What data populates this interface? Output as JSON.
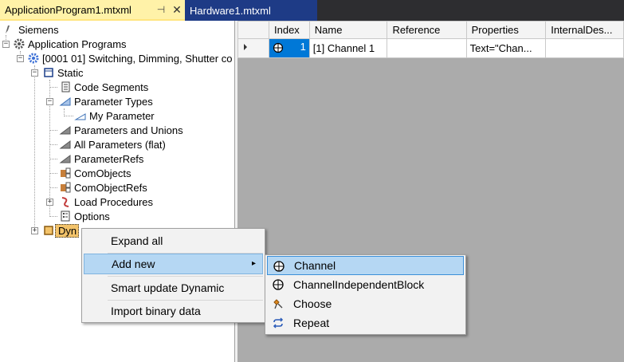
{
  "tabs": {
    "active_label": "ApplicationProgram1.mtxml",
    "pin_icon": "pin-icon",
    "close_icon": "close-icon",
    "inactive_label": "Hardware1.mtxml"
  },
  "tree": {
    "root": "Siemens",
    "app_programs": "Application Programs",
    "program": "[0001 01] Switching, Dimming, Shutter co",
    "static": "Static",
    "code_segments": "Code Segments",
    "parameter_types": "Parameter Types",
    "my_parameter": "My Parameter",
    "parameters_and_unions": "Parameters and Unions",
    "all_parameters": "All Parameters (flat)",
    "parameter_refs": "ParameterRefs",
    "com_objects": "ComObjects",
    "com_object_refs": "ComObjectRefs",
    "load_procedures": "Load Procedures",
    "options": "Options",
    "dynamic": "Dyn"
  },
  "grid": {
    "columns": [
      "Index",
      "Name",
      "Reference",
      "Properties",
      "InternalDes..."
    ],
    "rows": [
      {
        "index": "1",
        "name": "[1] Channel 1",
        "reference": "",
        "properties": "Text=\"Chan...",
        "internal": ""
      }
    ]
  },
  "context_menu": {
    "items": [
      {
        "label": "Expand all"
      },
      {
        "label": "Add new",
        "has_submenu": true
      },
      {
        "label": "Smart update Dynamic"
      },
      {
        "label": "Import binary data"
      }
    ],
    "arrow": "▸"
  },
  "submenu": {
    "items": [
      {
        "label": "Channel",
        "icon": "channel-icon"
      },
      {
        "label": "ChannelIndependentBlock",
        "icon": "channel-independent-block-icon"
      },
      {
        "label": "Choose",
        "icon": "choose-icon"
      },
      {
        "label": "Repeat",
        "icon": "repeat-icon"
      }
    ]
  },
  "colors": {
    "active_tab": "#fff2a8",
    "inactive_tab": "#1e3b86",
    "tabstrip_bg": "#2d2d30",
    "grid_bg": "#ababab",
    "selection": "#0078d7",
    "menu_highlight": "#b5d7f3"
  }
}
